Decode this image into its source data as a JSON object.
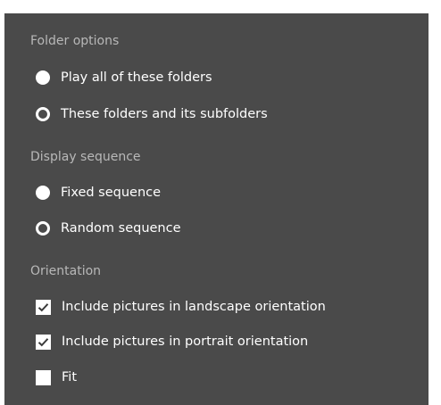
{
  "folder_options": {
    "title": "Folder options",
    "options": [
      {
        "label": "Play all of these folders",
        "selected": true
      },
      {
        "label": "These folders and its subfolders",
        "selected": false
      }
    ]
  },
  "display_sequence": {
    "title": "Display sequence",
    "options": [
      {
        "label": "Fixed sequence",
        "selected": true
      },
      {
        "label": "Random sequence",
        "selected": false
      }
    ]
  },
  "orientation": {
    "title": "Orientation",
    "checkboxes": [
      {
        "label": "Include pictures in landscape orientation",
        "checked": true
      },
      {
        "label": "Include pictures in portrait orientation",
        "checked": true
      },
      {
        "label": "Fit",
        "checked": false
      }
    ]
  },
  "colors": {
    "panel_bg": "#4a4a4a",
    "section_title": "#b8b8b8",
    "text": "#ffffff",
    "check_mark": "#3a3a3a"
  },
  "icons": {
    "radio_selected": "radio-filled-icon",
    "radio_unselected": "radio-ring-icon",
    "checkbox_checked": "checkmark-icon",
    "checkbox_unchecked": "empty-checkbox-icon"
  }
}
